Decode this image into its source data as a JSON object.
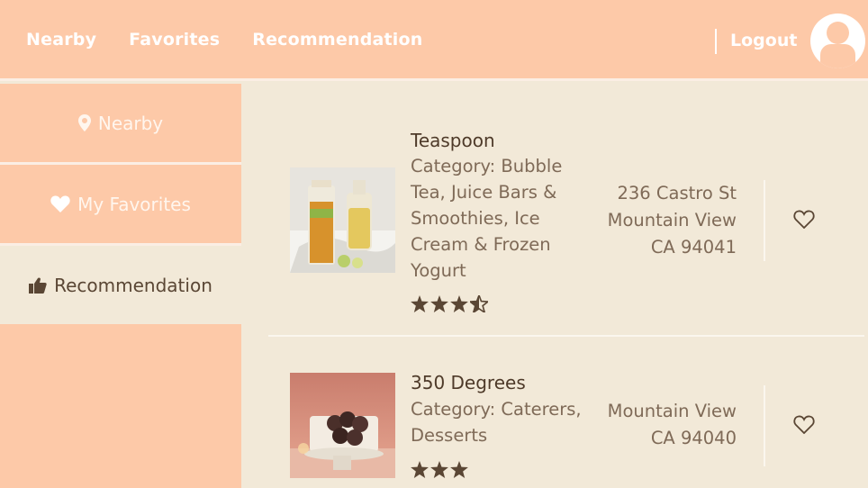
{
  "nav": {
    "nearby": "Nearby",
    "favorites": "Favorites",
    "recommendation": "Recommendation",
    "logout": "Logout"
  },
  "sidebar": {
    "items": [
      {
        "label": "Nearby",
        "icon": "map-pin-icon"
      },
      {
        "label": "My Favorites",
        "icon": "heart-icon"
      },
      {
        "label": "Recommendation",
        "icon": "thumbs-up-icon",
        "active": true
      }
    ]
  },
  "results": [
    {
      "name": "Teaspoon",
      "category": "Category: Bubble Tea, Juice Bars & Smoothies, Ice Cream & Frozen Yogurt",
      "rating": 3.5,
      "address_lines": [
        "236 Castro St",
        "Mountain View",
        "CA 94041"
      ]
    },
    {
      "name": "350 Degrees",
      "category": "Category: Caterers, Desserts",
      "rating": 3,
      "address_lines": [
        "Mountain View",
        "CA 94040"
      ]
    }
  ],
  "colors": {
    "header": "#fdc9a8",
    "content": "#f2e9d8",
    "accent_text": "#5a4634"
  }
}
